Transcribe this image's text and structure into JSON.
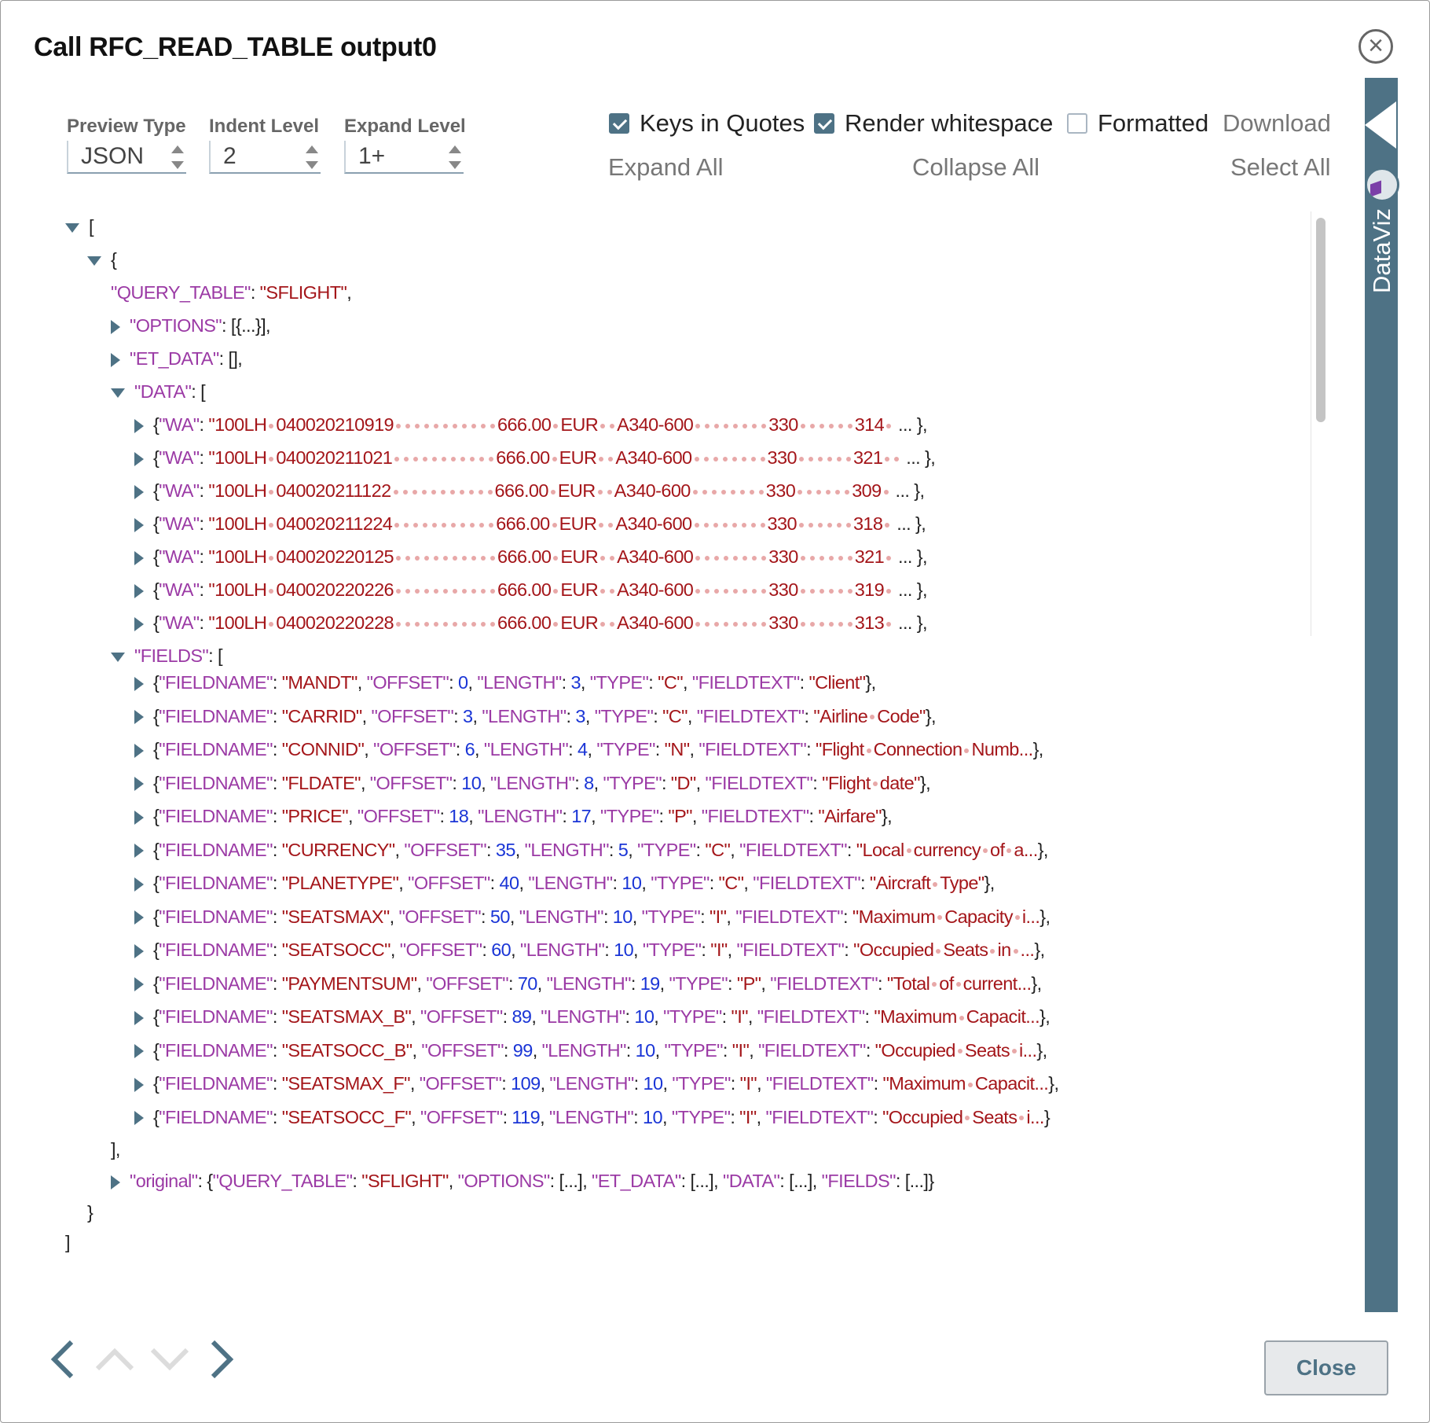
{
  "dialog": {
    "title": "Call RFC_READ_TABLE output0",
    "close_label": "Close"
  },
  "controls": {
    "preview_type": {
      "label": "Preview Type",
      "value": "JSON"
    },
    "indent_level": {
      "label": "Indent Level",
      "value": "2"
    },
    "expand_level": {
      "label": "Expand Level",
      "value": "1+"
    },
    "keys_in_quotes": {
      "label": "Keys in Quotes",
      "checked": true
    },
    "render_whitespace": {
      "label": "Render whitespace",
      "checked": true
    },
    "formatted": {
      "label": "Formatted",
      "checked": false
    },
    "download": "Download",
    "expand_all": "Expand All",
    "collapse_all": "Collapse All",
    "select_all": "Select All"
  },
  "sidebar": {
    "label": "DataViz"
  },
  "json": {
    "query_table_key": "\"QUERY_TABLE\"",
    "query_table_val": "\"SFLIGHT\"",
    "options_key": "\"OPTIONS\"",
    "options_val": "[{...}],",
    "et_data_key": "\"ET_DATA\"",
    "et_data_val": "[],",
    "data_key": "\"DATA\"",
    "fields_key": "\"FIELDS\"",
    "original_line": {
      "key": "\"original\"",
      "q_key": "\"QUERY_TABLE\"",
      "q_val": "\"SFLIGHT\"",
      "o_key": "\"OPTIONS\"",
      "e_key": "\"ET_DATA\"",
      "d_key": "\"DATA\"",
      "f_key": "\"FIELDS\"",
      "collapsed": "[...]"
    },
    "data_rows": [
      {
        "prefix": "\"100LH",
        "date": "040020210919",
        "price": "666.00",
        "cur": "EUR",
        "plane": "A340-600",
        "max": "330",
        "occ": "314",
        "end": "},"
      },
      {
        "prefix": "\"100LH",
        "date": "040020211021",
        "price": "666.00",
        "cur": "EUR",
        "plane": "A340-600",
        "max": "330",
        "occ": "321",
        "end": "...},"
      },
      {
        "prefix": "\"100LH",
        "date": "040020211122",
        "price": "666.00",
        "cur": "EUR",
        "plane": "A340-600",
        "max": "330",
        "occ": "309",
        "end": "},"
      },
      {
        "prefix": "\"100LH",
        "date": "040020211224",
        "price": "666.00",
        "cur": "EUR",
        "plane": "A340-600",
        "max": "330",
        "occ": "318",
        "end": "},"
      },
      {
        "prefix": "\"100LH",
        "date": "040020220125",
        "price": "666.00",
        "cur": "EUR",
        "plane": "A340-600",
        "max": "330",
        "occ": "321",
        "end": "},"
      },
      {
        "prefix": "\"100LH",
        "date": "040020220226",
        "price": "666.00",
        "cur": "EUR",
        "plane": "A340-600",
        "max": "330",
        "occ": "319",
        "end": "...},"
      },
      {
        "prefix": "\"100LH",
        "date": "040020220228",
        "price": "666.00",
        "cur": "EUR",
        "plane": "A340-600",
        "max": "330",
        "occ": "313",
        "end": "...},"
      }
    ],
    "fields": [
      {
        "name": "\"MANDT\"",
        "offset": "0",
        "length": "3",
        "type": "\"C\"",
        "text": "\"Client\"",
        "end": "},"
      },
      {
        "name": "\"CARRID\"",
        "offset": "3",
        "length": "3",
        "type": "\"C\"",
        "text": "\"Airline Code\"",
        "end": "},"
      },
      {
        "name": "\"CONNID\"",
        "offset": "6",
        "length": "4",
        "type": "\"N\"",
        "text": "\"Flight Connection Numb...",
        "end": "},"
      },
      {
        "name": "\"FLDATE\"",
        "offset": "10",
        "length": "8",
        "type": "\"D\"",
        "text": "\"Flight date\"",
        "end": "},"
      },
      {
        "name": "\"PRICE\"",
        "offset": "18",
        "length": "17",
        "type": "\"P\"",
        "text": "\"Airfare\"",
        "end": "},"
      },
      {
        "name": "\"CURRENCY\"",
        "offset": "35",
        "length": "5",
        "type": "\"C\"",
        "text": "\"Local currency of a...",
        "end": "},"
      },
      {
        "name": "\"PLANETYPE\"",
        "offset": "40",
        "length": "10",
        "type": "\"C\"",
        "text": "\"Aircraft Type\"",
        "end": "},"
      },
      {
        "name": "\"SEATSMAX\"",
        "offset": "50",
        "length": "10",
        "type": "\"I\"",
        "text": "\"Maximum Capacity i...",
        "end": "},"
      },
      {
        "name": "\"SEATSOCC\"",
        "offset": "60",
        "length": "10",
        "type": "\"I\"",
        "text": "\"Occupied Seats in ...",
        "end": "},"
      },
      {
        "name": "\"PAYMENTSUM\"",
        "offset": "70",
        "length": "19",
        "type": "\"P\"",
        "text": "\"Total of current...",
        "end": "},"
      },
      {
        "name": "\"SEATSMAX_B\"",
        "offset": "89",
        "length": "10",
        "type": "\"I\"",
        "text": "\"Maximum Capacit...",
        "end": "},"
      },
      {
        "name": "\"SEATSOCC_B\"",
        "offset": "99",
        "length": "10",
        "type": "\"I\"",
        "text": "\"Occupied Seats i...",
        "end": "},"
      },
      {
        "name": "\"SEATSMAX_F\"",
        "offset": "109",
        "length": "10",
        "type": "\"I\"",
        "text": "\"Maximum Capacit...",
        "end": "},"
      },
      {
        "name": "\"SEATSOCC_F\"",
        "offset": "119",
        "length": "10",
        "type": "\"I\"",
        "text": "\"Occupied Seats i...",
        "end": "}"
      }
    ]
  },
  "colors": {
    "accent": "#4e7285",
    "key": "#9b3aa5",
    "string": "#a4161a",
    "number": "#1a35d6"
  }
}
